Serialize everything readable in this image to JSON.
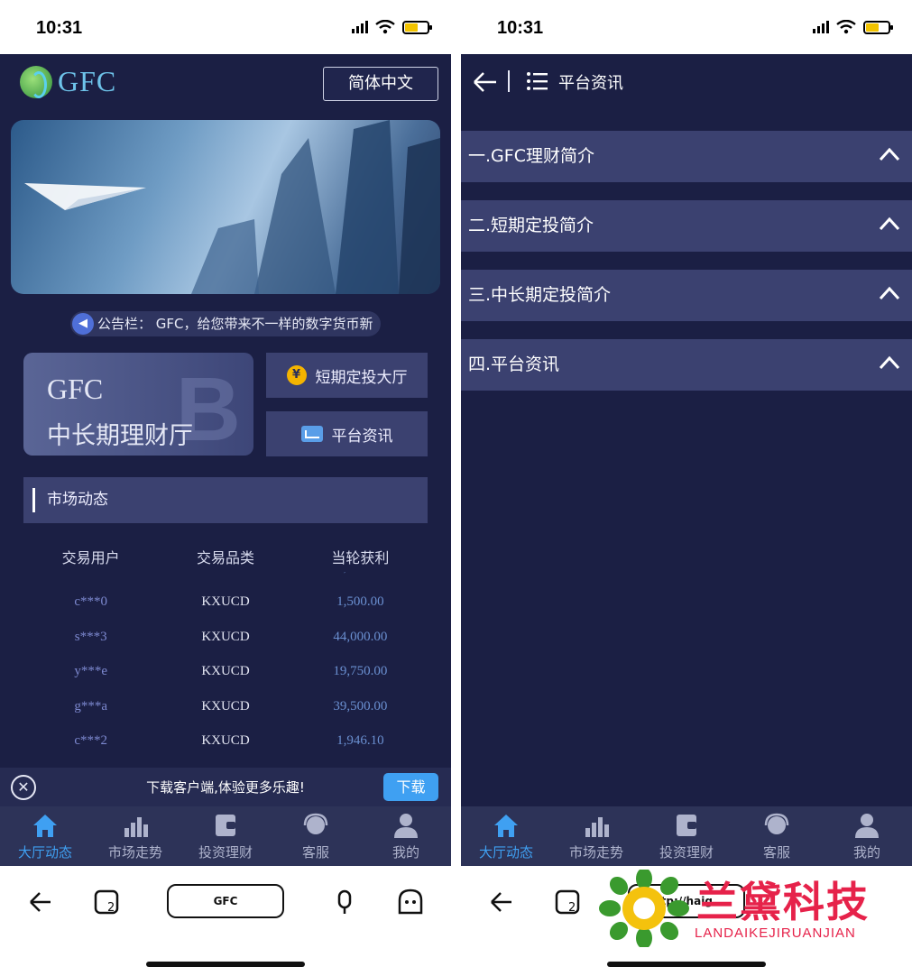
{
  "status": {
    "time": "10:31"
  },
  "left": {
    "logo_text": "GFC",
    "language_button": "简体中文",
    "notice_text": "公告栏：  GFC，给您带来不一样的数字货币新",
    "card": {
      "line1": "GFC",
      "line2": "中长期理财厅"
    },
    "short_term_hall": "短期定投大厅",
    "platform_news": "平台资讯",
    "market_section_title": "市场动态",
    "table": {
      "headers": [
        "交易用户",
        "交易品类",
        "当轮获利"
      ],
      "rows": [
        {
          "user": "c***0",
          "product": "KXUCD",
          "profit": "1,500.00"
        },
        {
          "user": "s***3",
          "product": "KXUCD",
          "profit": "44,000.00"
        },
        {
          "user": "y***e",
          "product": "KXUCD",
          "profit": "19,750.00"
        },
        {
          "user": "g***a",
          "product": "KXUCD",
          "profit": "39,500.00"
        },
        {
          "user": "c***2",
          "product": "KXUCD",
          "profit": "1,946.10"
        }
      ]
    },
    "download_bar": {
      "text": "下载客户端,体验更多乐趣!",
      "button": "下载"
    },
    "browser_url": "GFC"
  },
  "tabs": [
    {
      "label": "大厅动态",
      "icon": "home-icon",
      "active": true
    },
    {
      "label": "市场走势",
      "icon": "bar-chart-icon",
      "active": false
    },
    {
      "label": "投资理财",
      "icon": "wallet-icon",
      "active": false
    },
    {
      "label": "客服",
      "icon": "headset-icon",
      "active": false
    },
    {
      "label": "我的",
      "icon": "user-icon",
      "active": false
    }
  ],
  "right": {
    "header_title": "平台资讯",
    "sections": [
      {
        "title": "一.GFC理财简介"
      },
      {
        "title": "二.短期定投简介"
      },
      {
        "title": "三.中长期定投简介"
      },
      {
        "title": "四.平台资讯"
      }
    ],
    "browser_url": "http://haig..."
  },
  "watermark": {
    "title": "兰黛科技",
    "subtitle": "LANDAIKEJIRUANJIAN"
  },
  "colors": {
    "app_bg": "#1b1f44",
    "panel": "#3b4170",
    "accent": "#3fa0f2",
    "tabbar": "#2d3358"
  }
}
